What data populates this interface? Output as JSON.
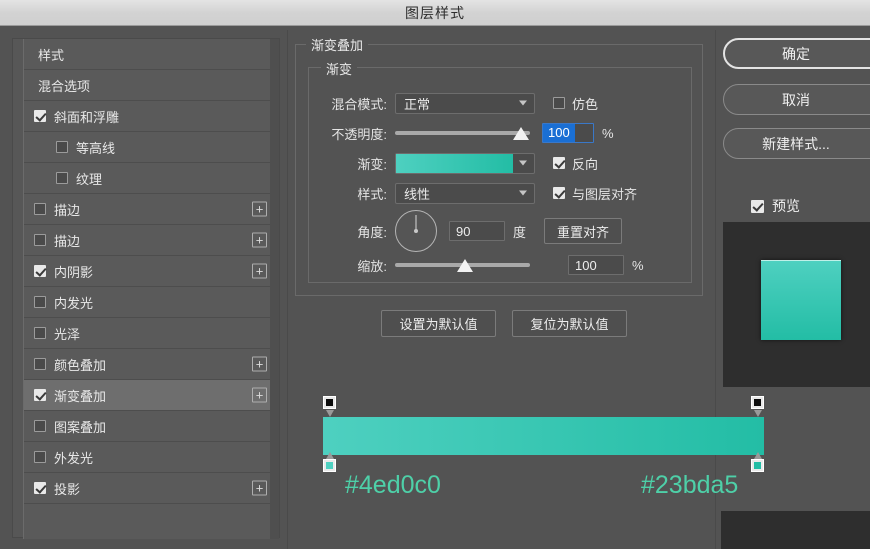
{
  "window": {
    "title": "图层样式"
  },
  "sidebar": {
    "items": [
      {
        "label": "样式",
        "checkbox": "none",
        "checked": false,
        "plus": false,
        "sub": false,
        "selected": false
      },
      {
        "label": "混合选项",
        "checkbox": "none",
        "checked": false,
        "plus": false,
        "sub": false,
        "selected": false
      },
      {
        "label": "斜面和浮雕",
        "checkbox": "yes",
        "checked": true,
        "plus": false,
        "sub": false,
        "selected": false
      },
      {
        "label": "等高线",
        "checkbox": "yes",
        "checked": false,
        "plus": false,
        "sub": true,
        "selected": false
      },
      {
        "label": "纹理",
        "checkbox": "yes",
        "checked": false,
        "plus": false,
        "sub": true,
        "selected": false
      },
      {
        "label": "描边",
        "checkbox": "yes",
        "checked": false,
        "plus": true,
        "sub": false,
        "selected": false
      },
      {
        "label": "描边",
        "checkbox": "yes",
        "checked": false,
        "plus": true,
        "sub": false,
        "selected": false
      },
      {
        "label": "内阴影",
        "checkbox": "yes",
        "checked": true,
        "plus": true,
        "sub": false,
        "selected": false
      },
      {
        "label": "内发光",
        "checkbox": "yes",
        "checked": false,
        "plus": false,
        "sub": false,
        "selected": false
      },
      {
        "label": "光泽",
        "checkbox": "yes",
        "checked": false,
        "plus": false,
        "sub": false,
        "selected": false
      },
      {
        "label": "颜色叠加",
        "checkbox": "yes",
        "checked": false,
        "plus": true,
        "sub": false,
        "selected": false
      },
      {
        "label": "渐变叠加",
        "checkbox": "yes",
        "checked": true,
        "plus": true,
        "sub": false,
        "selected": true
      },
      {
        "label": "图案叠加",
        "checkbox": "yes",
        "checked": false,
        "plus": false,
        "sub": false,
        "selected": false
      },
      {
        "label": "外发光",
        "checkbox": "yes",
        "checked": false,
        "plus": false,
        "sub": false,
        "selected": false
      },
      {
        "label": "投影",
        "checkbox": "yes",
        "checked": true,
        "plus": true,
        "sub": false,
        "selected": false
      }
    ],
    "plus_glyph": "+"
  },
  "panel": {
    "group_title": "渐变叠加",
    "subgroup_title": "渐变",
    "blend_mode": {
      "label": "混合模式:",
      "value": "正常"
    },
    "dither": {
      "label": "仿色",
      "checked": false
    },
    "opacity": {
      "label": "不透明度:",
      "value": "100",
      "unit": "%",
      "slider_pct": 100
    },
    "gradient": {
      "label": "渐变:",
      "start": "#4ed0c0",
      "end": "#23bda5"
    },
    "reverse": {
      "label": "反向",
      "checked": true
    },
    "style": {
      "label": "样式:",
      "value": "线性"
    },
    "align_with_layer": {
      "label": "与图层对齐",
      "checked": true
    },
    "angle": {
      "label": "角度:",
      "value": "90",
      "unit": "度"
    },
    "reset_align_button": "重置对齐",
    "scale": {
      "label": "缩放:",
      "value": "100",
      "unit": "%",
      "slider_pct": 45
    },
    "set_default_button": "设置为默认值",
    "reset_default_button": "复位为默认值"
  },
  "gradient_strip": {
    "start_hex": "#4ed0c0",
    "end_hex": "#23bda5",
    "start_label": "#4ed0c0",
    "end_label": "#23bda5",
    "label_color": "#4ed0a8"
  },
  "right": {
    "ok_button": "确定",
    "cancel_button": "取消",
    "new_style_button": "新建样式...",
    "preview": {
      "label": "预览",
      "checked": true
    }
  }
}
